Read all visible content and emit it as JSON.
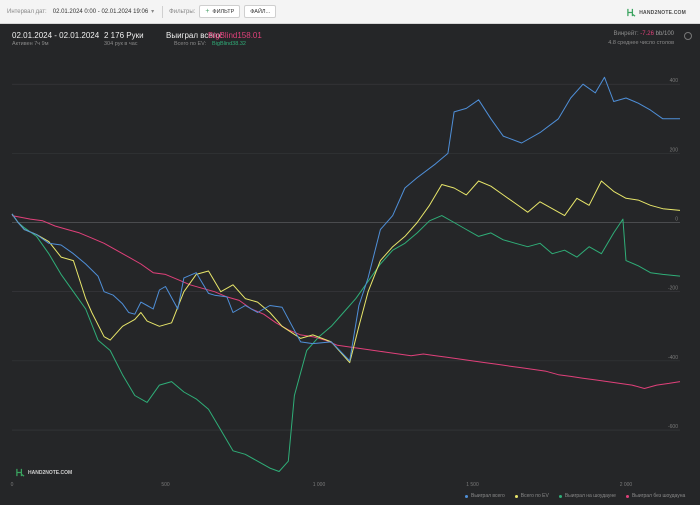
{
  "toolbar": {
    "interval_label": "Интервал дат:",
    "interval_value": "02.01.2024 0:00 - 02.01.2024 19:06",
    "filters_label": "Фильтры:",
    "filter_button": "ФИЛЬТР",
    "file_button": "ФАЙЛ...",
    "brand": "HAND2NOTE.COM"
  },
  "stats": {
    "date_range": "02.01.2024 - 02.01.2024",
    "active_time": "Активен 7ч 9м",
    "hands": "2 176 Руки",
    "hands_per_hour": "304 рук в час",
    "won_total_label": "Выиграл всего:",
    "won_total_value": "BigBlind158.01",
    "ev_total_label": "Всего по EV:",
    "ev_total_value": "BigBlind38.32",
    "winrate_label": "Винрейт:",
    "winrate_value": "-7.26",
    "winrate_per": "bb/100",
    "avg_tables": "4.8 среднее число столов"
  },
  "watermark": "HAND2NOTE.COM",
  "colors": {
    "background": "#252628",
    "won": "#4f8fd8",
    "ev": "#e8e66a",
    "showdown": "#2fae78",
    "non_showdown": "#e0407a",
    "grid": "#3a3b3e"
  },
  "chart_data": {
    "type": "line",
    "xlabel": "",
    "ylabel": "",
    "xlim": [
      0,
      2176
    ],
    "ylim": [
      -730,
      470
    ],
    "x_ticks": [
      "0",
      "500",
      "1 000",
      "1 500",
      "2 000"
    ],
    "x_tick_values": [
      0,
      500,
      1000,
      1500,
      2000
    ],
    "y_ticks": [
      "400",
      "200",
      "0",
      "-200",
      "-400",
      "-600"
    ],
    "y_tick_values": [
      400,
      200,
      0,
      -200,
      -400,
      -600
    ],
    "grid": true,
    "legend_position": "bottom-right",
    "series": [
      {
        "name": "Выиграл всего",
        "color": "#4f8fd8",
        "points": [
          [
            0,
            25
          ],
          [
            20,
            0
          ],
          [
            40,
            -20
          ],
          [
            80,
            -35
          ],
          [
            120,
            -60
          ],
          [
            160,
            -65
          ],
          [
            200,
            -90
          ],
          [
            240,
            -120
          ],
          [
            280,
            -155
          ],
          [
            300,
            -200
          ],
          [
            330,
            -210
          ],
          [
            360,
            -235
          ],
          [
            380,
            -260
          ],
          [
            400,
            -265
          ],
          [
            420,
            -230
          ],
          [
            440,
            -240
          ],
          [
            460,
            -250
          ],
          [
            480,
            -195
          ],
          [
            500,
            -185
          ],
          [
            540,
            -250
          ],
          [
            560,
            -160
          ],
          [
            600,
            -145
          ],
          [
            640,
            -205
          ],
          [
            660,
            -210
          ],
          [
            700,
            -215
          ],
          [
            720,
            -260
          ],
          [
            760,
            -240
          ],
          [
            800,
            -260
          ],
          [
            840,
            -240
          ],
          [
            880,
            -245
          ],
          [
            940,
            -345
          ],
          [
            980,
            -350
          ],
          [
            1040,
            -345
          ],
          [
            1100,
            -400
          ],
          [
            1130,
            -240
          ],
          [
            1160,
            -160
          ],
          [
            1200,
            -20
          ],
          [
            1240,
            20
          ],
          [
            1280,
            100
          ],
          [
            1320,
            130
          ],
          [
            1380,
            170
          ],
          [
            1420,
            200
          ],
          [
            1440,
            320
          ],
          [
            1480,
            330
          ],
          [
            1520,
            355
          ],
          [
            1560,
            300
          ],
          [
            1600,
            250
          ],
          [
            1660,
            230
          ],
          [
            1720,
            260
          ],
          [
            1780,
            300
          ],
          [
            1820,
            360
          ],
          [
            1860,
            400
          ],
          [
            1900,
            375
          ],
          [
            1930,
            420
          ],
          [
            1960,
            350
          ],
          [
            2000,
            360
          ],
          [
            2040,
            345
          ],
          [
            2080,
            325
          ],
          [
            2120,
            300
          ],
          [
            2176,
            300
          ]
        ]
      },
      {
        "name": "Всего по EV",
        "color": "#e8e66a",
        "points": [
          [
            0,
            25
          ],
          [
            20,
            0
          ],
          [
            40,
            -20
          ],
          [
            80,
            -35
          ],
          [
            120,
            -55
          ],
          [
            160,
            -100
          ],
          [
            200,
            -110
          ],
          [
            240,
            -220
          ],
          [
            260,
            -260
          ],
          [
            300,
            -330
          ],
          [
            320,
            -340
          ],
          [
            360,
            -300
          ],
          [
            400,
            -280
          ],
          [
            420,
            -260
          ],
          [
            440,
            -285
          ],
          [
            480,
            -300
          ],
          [
            520,
            -290
          ],
          [
            560,
            -200
          ],
          [
            600,
            -150
          ],
          [
            640,
            -140
          ],
          [
            680,
            -200
          ],
          [
            720,
            -180
          ],
          [
            760,
            -220
          ],
          [
            800,
            -230
          ],
          [
            840,
            -260
          ],
          [
            880,
            -300
          ],
          [
            940,
            -335
          ],
          [
            980,
            -325
          ],
          [
            1040,
            -345
          ],
          [
            1100,
            -405
          ],
          [
            1130,
            -300
          ],
          [
            1160,
            -200
          ],
          [
            1200,
            -110
          ],
          [
            1240,
            -70
          ],
          [
            1280,
            -40
          ],
          [
            1320,
            0
          ],
          [
            1360,
            50
          ],
          [
            1400,
            110
          ],
          [
            1440,
            100
          ],
          [
            1480,
            80
          ],
          [
            1520,
            120
          ],
          [
            1560,
            105
          ],
          [
            1600,
            80
          ],
          [
            1640,
            55
          ],
          [
            1680,
            30
          ],
          [
            1720,
            60
          ],
          [
            1760,
            40
          ],
          [
            1800,
            20
          ],
          [
            1840,
            70
          ],
          [
            1880,
            50
          ],
          [
            1920,
            120
          ],
          [
            1960,
            90
          ],
          [
            2000,
            70
          ],
          [
            2040,
            65
          ],
          [
            2080,
            50
          ],
          [
            2120,
            40
          ],
          [
            2176,
            35
          ]
        ]
      },
      {
        "name": "Выиграл на шоудауне",
        "color": "#2fae78",
        "points": [
          [
            0,
            25
          ],
          [
            20,
            0
          ],
          [
            40,
            -15
          ],
          [
            80,
            -40
          ],
          [
            120,
            -90
          ],
          [
            160,
            -150
          ],
          [
            200,
            -200
          ],
          [
            240,
            -250
          ],
          [
            280,
            -340
          ],
          [
            320,
            -370
          ],
          [
            360,
            -440
          ],
          [
            400,
            -500
          ],
          [
            440,
            -520
          ],
          [
            480,
            -470
          ],
          [
            520,
            -460
          ],
          [
            560,
            -490
          ],
          [
            600,
            -510
          ],
          [
            640,
            -540
          ],
          [
            680,
            -600
          ],
          [
            720,
            -660
          ],
          [
            760,
            -670
          ],
          [
            800,
            -690
          ],
          [
            840,
            -710
          ],
          [
            870,
            -720
          ],
          [
            900,
            -690
          ],
          [
            920,
            -500
          ],
          [
            960,
            -370
          ],
          [
            1000,
            -330
          ],
          [
            1040,
            -300
          ],
          [
            1080,
            -260
          ],
          [
            1120,
            -220
          ],
          [
            1160,
            -170
          ],
          [
            1200,
            -120
          ],
          [
            1240,
            -80
          ],
          [
            1280,
            -60
          ],
          [
            1320,
            -30
          ],
          [
            1360,
            5
          ],
          [
            1400,
            20
          ],
          [
            1440,
            0
          ],
          [
            1480,
            -20
          ],
          [
            1520,
            -40
          ],
          [
            1560,
            -30
          ],
          [
            1600,
            -50
          ],
          [
            1640,
            -60
          ],
          [
            1680,
            -70
          ],
          [
            1720,
            -60
          ],
          [
            1760,
            -90
          ],
          [
            1800,
            -80
          ],
          [
            1840,
            -100
          ],
          [
            1880,
            -70
          ],
          [
            1920,
            -90
          ],
          [
            1960,
            -30
          ],
          [
            1990,
            10
          ],
          [
            2000,
            -110
          ],
          [
            2040,
            -125
          ],
          [
            2080,
            -145
          ],
          [
            2120,
            -150
          ],
          [
            2176,
            -155
          ]
        ]
      },
      {
        "name": "Выиграл без шоудауна",
        "color": "#e0407a",
        "points": [
          [
            0,
            20
          ],
          [
            30,
            15
          ],
          [
            60,
            10
          ],
          [
            100,
            5
          ],
          [
            140,
            -10
          ],
          [
            180,
            -20
          ],
          [
            220,
            -30
          ],
          [
            260,
            -45
          ],
          [
            300,
            -60
          ],
          [
            340,
            -80
          ],
          [
            380,
            -100
          ],
          [
            420,
            -120
          ],
          [
            460,
            -145
          ],
          [
            500,
            -150
          ],
          [
            540,
            -165
          ],
          [
            580,
            -180
          ],
          [
            620,
            -190
          ],
          [
            660,
            -200
          ],
          [
            700,
            -215
          ],
          [
            740,
            -225
          ],
          [
            780,
            -250
          ],
          [
            820,
            -265
          ],
          [
            860,
            -290
          ],
          [
            900,
            -310
          ],
          [
            940,
            -325
          ],
          [
            980,
            -330
          ],
          [
            1020,
            -340
          ],
          [
            1060,
            -355
          ],
          [
            1100,
            -360
          ],
          [
            1140,
            -365
          ],
          [
            1180,
            -370
          ],
          [
            1220,
            -375
          ],
          [
            1260,
            -380
          ],
          [
            1300,
            -385
          ],
          [
            1340,
            -380
          ],
          [
            1380,
            -385
          ],
          [
            1420,
            -390
          ],
          [
            1460,
            -395
          ],
          [
            1500,
            -400
          ],
          [
            1540,
            -405
          ],
          [
            1580,
            -410
          ],
          [
            1620,
            -415
          ],
          [
            1660,
            -420
          ],
          [
            1700,
            -425
          ],
          [
            1740,
            -430
          ],
          [
            1780,
            -440
          ],
          [
            1820,
            -445
          ],
          [
            1860,
            -450
          ],
          [
            1900,
            -455
          ],
          [
            1940,
            -460
          ],
          [
            1980,
            -465
          ],
          [
            2020,
            -470
          ],
          [
            2060,
            -480
          ],
          [
            2100,
            -470
          ],
          [
            2140,
            -465
          ],
          [
            2176,
            -460
          ]
        ]
      }
    ]
  },
  "legend": [
    "Выиграл всего",
    "Всего по EV",
    "Выиграл на шоудауне",
    "Выиграл без шоудауна"
  ]
}
